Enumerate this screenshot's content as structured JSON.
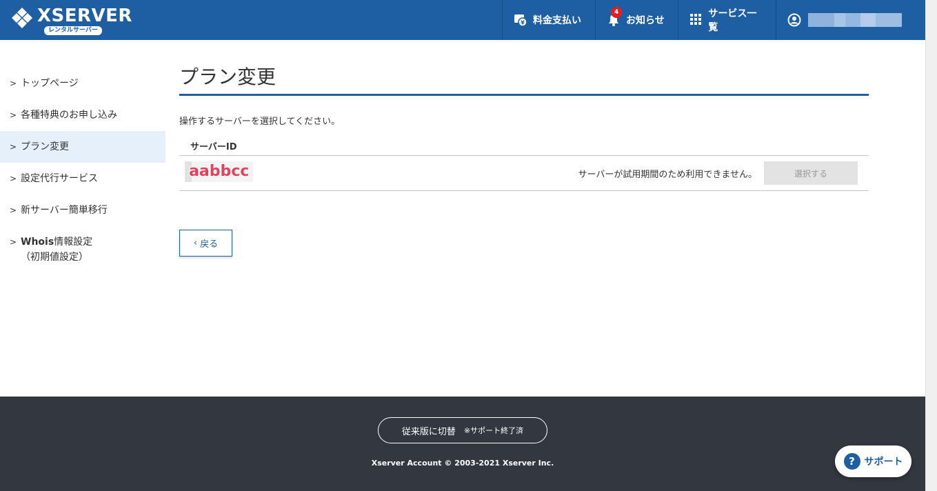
{
  "header": {
    "logo_text": "XSERVER",
    "logo_sub": "レンタルサーバー",
    "nav": {
      "payment_label": "料金支払い",
      "notice_label": "お知らせ",
      "notice_count": "4",
      "services_label": "サービス一覧"
    },
    "colors": {
      "header_bg": "#1e5fa3",
      "badge": "#e41c23"
    }
  },
  "sidebar": {
    "items": [
      {
        "label": "トップページ"
      },
      {
        "label": "各種特典のお申し込み"
      },
      {
        "label": "プラン変更",
        "active": true
      },
      {
        "label": "設定代行サービス"
      },
      {
        "label": "新サーバー簡単移行"
      },
      {
        "label_bold": "Whois",
        "label": "情報設定",
        "label_line2": "（初期値設定）"
      }
    ]
  },
  "main": {
    "title": "プラン変更",
    "instruction": "操作するサーバーを選択してください。",
    "table": {
      "header": "サーバーID",
      "rows": [
        {
          "server_id": "aabbcc",
          "note": "サーバーが試用期間のため利用できません。",
          "button": "選択する"
        }
      ]
    },
    "back_button": "戻る"
  },
  "footer": {
    "switch_label": "従来版に切替",
    "switch_note": "※サポート終了済",
    "copyright": "Xserver Account © 2003-2021 Xserver Inc."
  },
  "support_button": "サポート"
}
